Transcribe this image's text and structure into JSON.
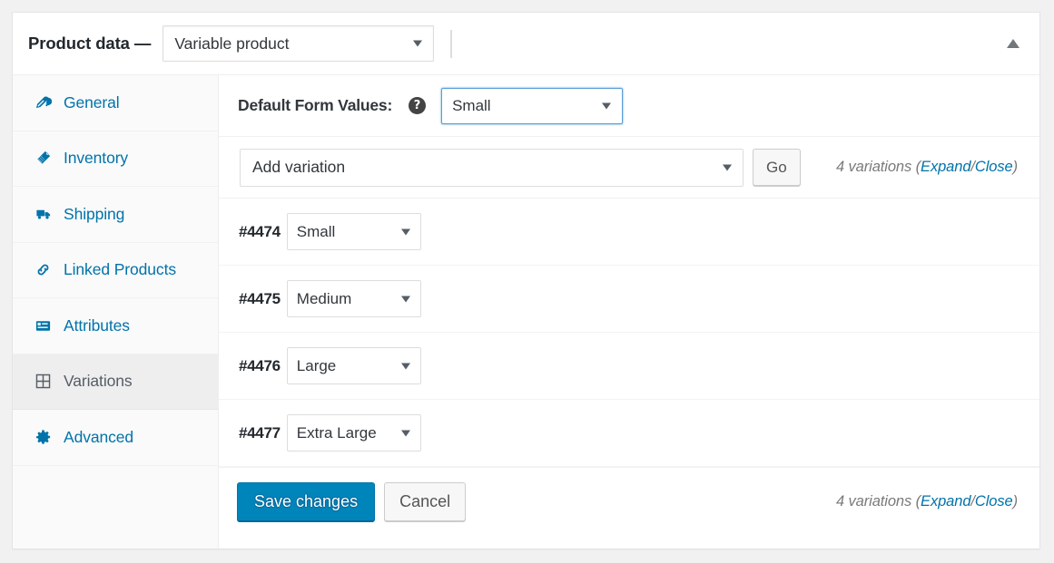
{
  "panel": {
    "title": "Product data —",
    "product_type": "Variable product",
    "toggle_icon": "caret-up-icon"
  },
  "tabs": [
    {
      "id": "general",
      "label": "General",
      "icon": "wrench-icon",
      "active": false
    },
    {
      "id": "inventory",
      "label": "Inventory",
      "icon": "tag-icon",
      "active": false
    },
    {
      "id": "shipping",
      "label": "Shipping",
      "icon": "truck-icon",
      "active": false
    },
    {
      "id": "linked-products",
      "label": "Linked Products",
      "icon": "link-icon",
      "active": false
    },
    {
      "id": "attributes",
      "label": "Attributes",
      "icon": "list-view-icon",
      "active": false
    },
    {
      "id": "variations",
      "label": "Variations",
      "icon": "grid-icon",
      "active": true
    },
    {
      "id": "advanced",
      "label": "Advanced",
      "icon": "gear-icon",
      "active": false
    }
  ],
  "defaults": {
    "label": "Default Form Values:",
    "help_icon": "help-icon",
    "help_glyph": "?",
    "value": "Small"
  },
  "toolbar": {
    "add_variation_value": "Add variation",
    "go_label": "Go",
    "count_text": "4 variations",
    "open_paren": "(",
    "expand_label": "Expand",
    "separator": "/",
    "close_label": "Close",
    "close_paren": ")"
  },
  "variations": [
    {
      "id": "#4474",
      "attribute": "Small"
    },
    {
      "id": "#4475",
      "attribute": "Medium"
    },
    {
      "id": "#4476",
      "attribute": "Large"
    },
    {
      "id": "#4477",
      "attribute": "Extra Large"
    }
  ],
  "footer": {
    "save_label": "Save changes",
    "cancel_label": "Cancel",
    "count_text": "4 variations",
    "open_paren": "(",
    "expand_label": "Expand",
    "separator": "/",
    "close_label": "Close",
    "close_paren": ")"
  },
  "colors": {
    "link": "#0073aa",
    "primary_button": "#0085ba",
    "focus_border": "#5b9dd9",
    "active_tab_bg": "#eeeeee",
    "page_bg": "#f1f1f1"
  }
}
